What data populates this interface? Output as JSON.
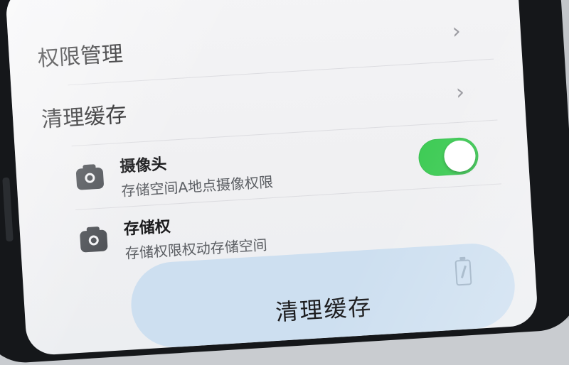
{
  "settings": {
    "permission_management": "权限管理",
    "clear_cache": "清理缓存"
  },
  "permissions": [
    {
      "title": "摄像头",
      "subtitle": "存储空间A地点摄像权限",
      "toggle_on": true
    },
    {
      "title": "存储权",
      "subtitle": "存储权限权动存储空间"
    }
  ],
  "clean_button": {
    "label": "清理缓存"
  },
  "colors": {
    "toggle_on": "#3ecb55",
    "button_bg": "#cddff0"
  },
  "icons": [
    "chevron-right-icon",
    "camera-icon",
    "battery-icon"
  ]
}
